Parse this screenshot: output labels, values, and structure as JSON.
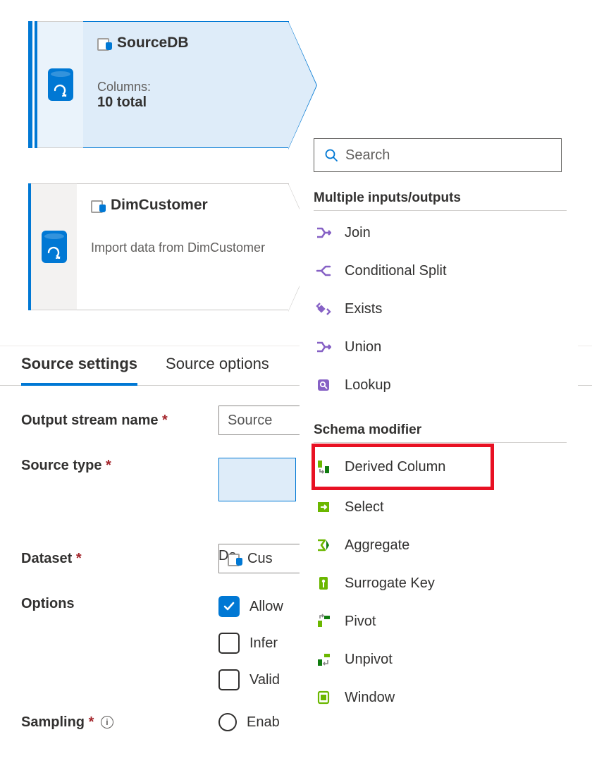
{
  "nodes": {
    "sourceDB": {
      "title": "SourceDB",
      "columns_label": "Columns:",
      "columns_total": "10 total"
    },
    "dimCustomer": {
      "title": "DimCustomer",
      "desc": "Import data from DimCustomer"
    }
  },
  "tabs": {
    "settings": "Source settings",
    "options": "Source options"
  },
  "form": {
    "output_stream_label": "Output stream name",
    "output_stream_value": "Source",
    "source_type_label": "Source type",
    "source_type_value": "Da",
    "dataset_label": "Dataset",
    "dataset_value": "Cus",
    "options_label": "Options",
    "opt_allow": "Allow",
    "opt_infer": "Infer",
    "opt_valid": "Valid",
    "sampling_label": "Sampling",
    "sampling_value": "Enab"
  },
  "popup": {
    "search_placeholder": "Search",
    "section_multi": "Multiple inputs/outputs",
    "section_schema": "Schema modifier",
    "items_multi": [
      "Join",
      "Conditional Split",
      "Exists",
      "Union",
      "Lookup"
    ],
    "items_schema": [
      "Derived Column",
      "Select",
      "Aggregate",
      "Surrogate Key",
      "Pivot",
      "Unpivot",
      "Window"
    ]
  }
}
